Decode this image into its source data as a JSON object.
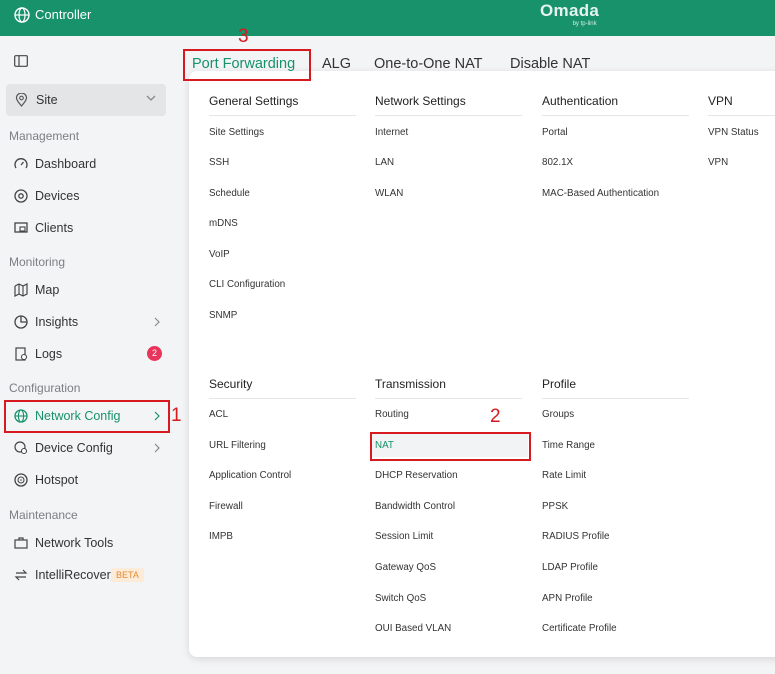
{
  "header": {
    "app_title": "Controller",
    "brand_name": "Omada",
    "brand_sub": "by tp-link",
    "accent_color": "#17926b"
  },
  "sidebar": {
    "site_label": "Site",
    "sections": {
      "management": "Management",
      "monitoring": "Monitoring",
      "configuration": "Configuration",
      "maintenance": "Maintenance"
    },
    "items": {
      "dashboard": "Dashboard",
      "devices": "Devices",
      "clients": "Clients",
      "map": "Map",
      "insights": "Insights",
      "logs": "Logs",
      "logs_badge": "2",
      "network_config": "Network Config",
      "device_config": "Device Config",
      "hotspot": "Hotspot",
      "network_tools": "Network Tools",
      "intellirecover": "IntelliRecover",
      "beta": "BETA"
    }
  },
  "tabs": [
    "Port Forwarding",
    "ALG",
    "One-to-One NAT",
    "Disable NAT"
  ],
  "annotations": [
    "1",
    "2",
    "3"
  ],
  "menu": {
    "general": {
      "title": "General Settings",
      "items": [
        "Site Settings",
        "SSH",
        "Schedule",
        "mDNS",
        "VoIP",
        "CLI Configuration",
        "SNMP"
      ]
    },
    "network": {
      "title": "Network Settings",
      "items": [
        "Internet",
        "LAN",
        "WLAN"
      ]
    },
    "auth": {
      "title": "Authentication",
      "items": [
        "Portal",
        "802.1X",
        "MAC-Based Authentication"
      ]
    },
    "vpn": {
      "title": "VPN",
      "items": [
        "VPN Status",
        "VPN"
      ]
    },
    "security": {
      "title": "Security",
      "items": [
        "ACL",
        "URL Filtering",
        "Application Control",
        "Firewall",
        "IMPB"
      ]
    },
    "transmission": {
      "title": "Transmission",
      "items": [
        "Routing",
        "NAT",
        "DHCP Reservation",
        "Bandwidth Control",
        "Session Limit",
        "Gateway QoS",
        "Switch QoS",
        "OUI Based VLAN"
      ]
    },
    "profile": {
      "title": "Profile",
      "items": [
        "Groups",
        "Time Range",
        "Rate Limit",
        "PPSK",
        "RADIUS Profile",
        "LDAP Profile",
        "APN Profile",
        "Certificate Profile"
      ]
    }
  }
}
